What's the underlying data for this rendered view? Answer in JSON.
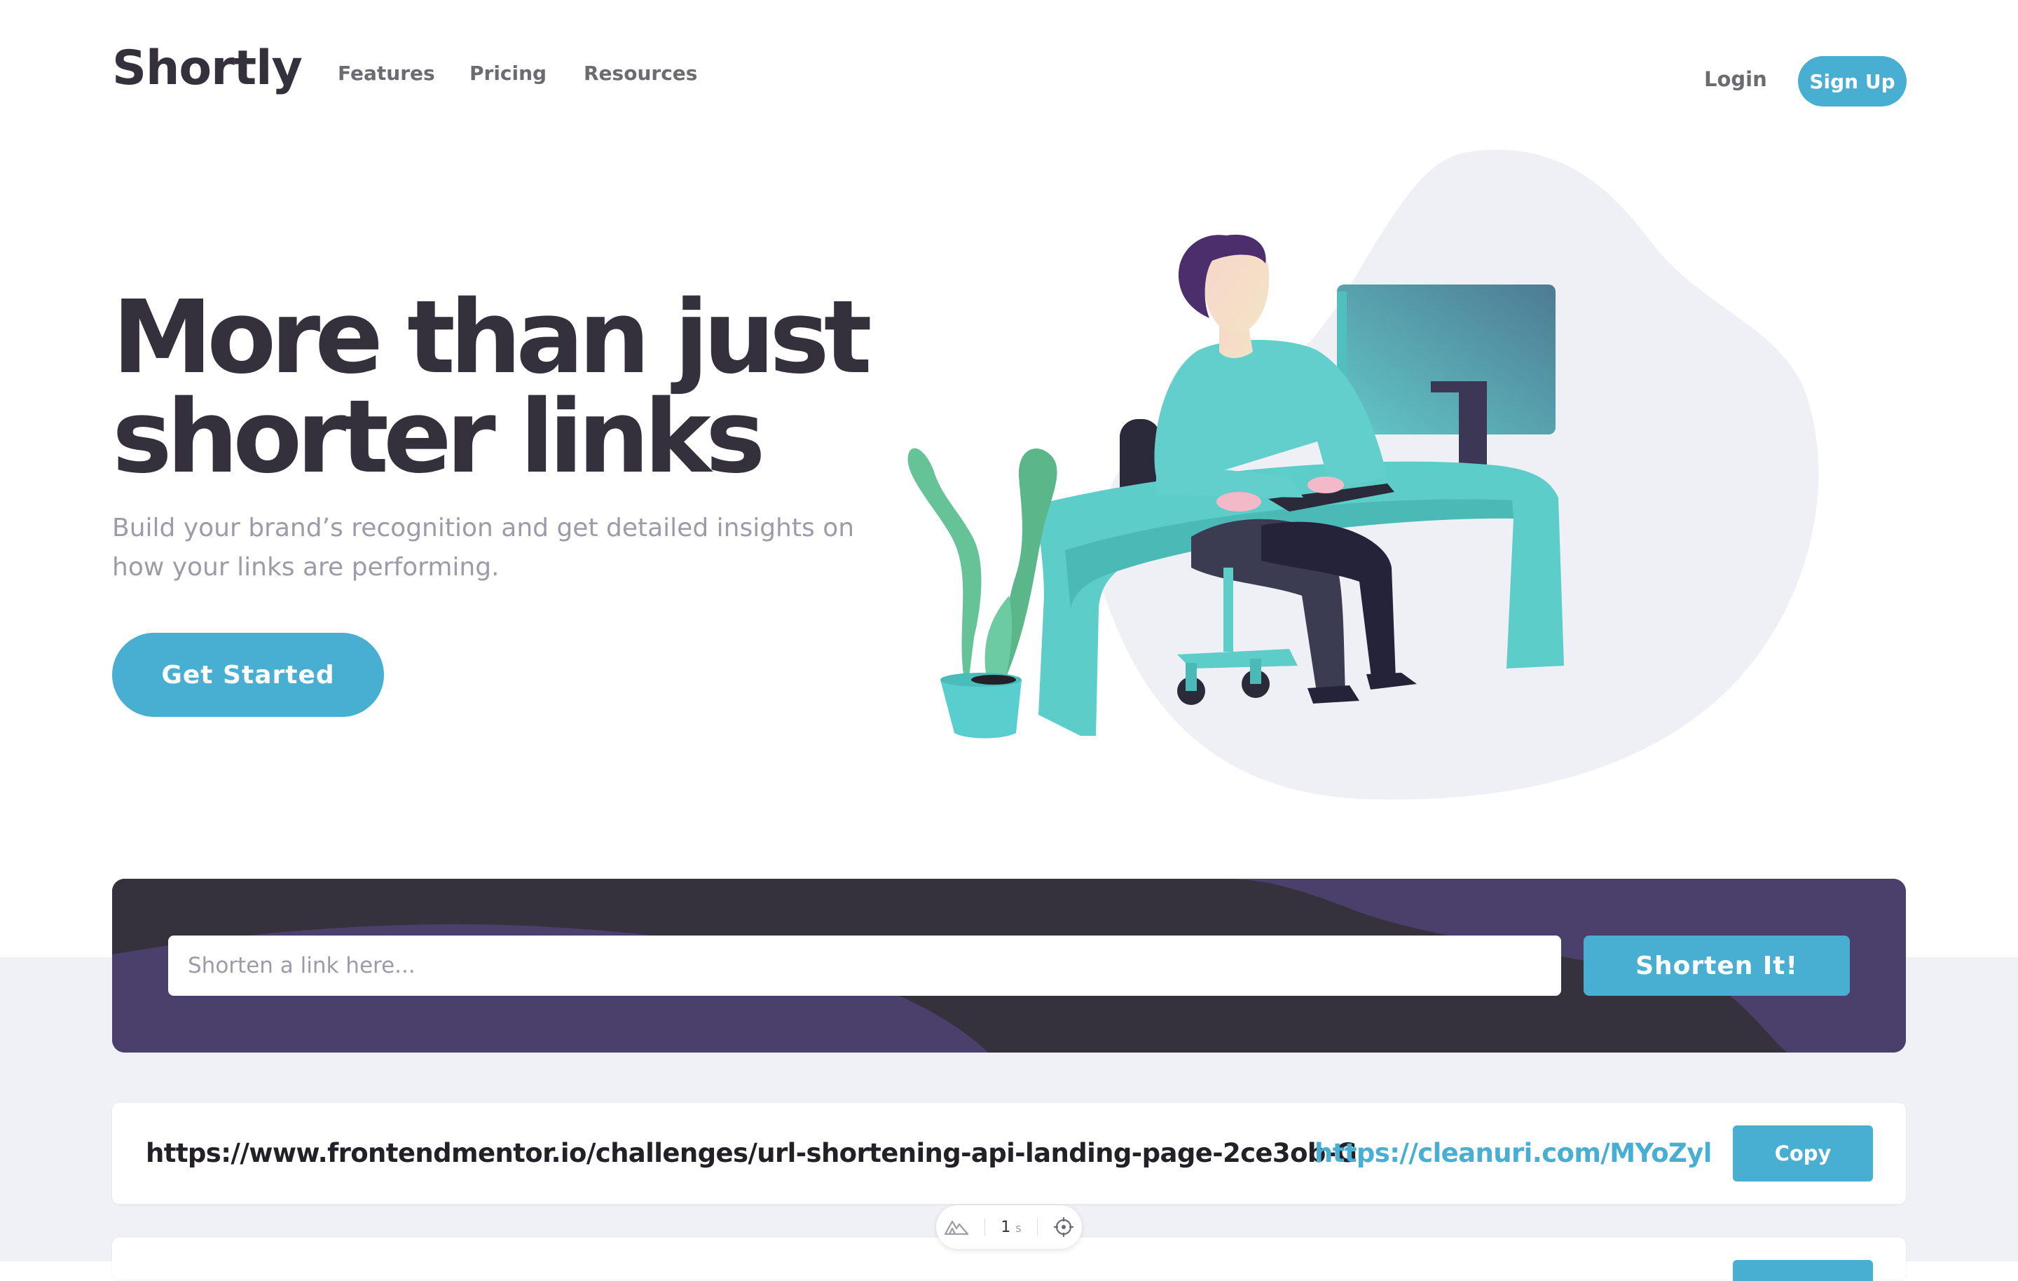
{
  "header": {
    "logo": "Shortly",
    "nav": [
      "Features",
      "Pricing",
      "Resources"
    ],
    "login": "Login",
    "signup": "Sign Up"
  },
  "hero": {
    "title_line1": "More than just",
    "title_line2": "shorter links",
    "subtitle": "Build your brand’s recognition and get detailed insights on how your links are performing.",
    "cta": "Get Started"
  },
  "shorten": {
    "placeholder": "Shorten a link here...",
    "button": "Shorten It!"
  },
  "results": [
    {
      "original": "https://www.frontendmentor.io/challenges/url-shortening-api-landing-page-2ce3ob-G",
      "short": "https://cleanuri.com/MYoZyl",
      "copy": "Copy"
    }
  ],
  "devbar": {
    "time": "1",
    "unit": "s",
    "logo_icon": "nuxt-logo-icon",
    "target_icon": "crosshair-icon"
  },
  "colors": {
    "primary": "#48aed2",
    "dark_violet": "#3a3054",
    "dark_text": "#34313d",
    "gray_text": "#9e9aa8",
    "light_bg": "#f0f1f6"
  }
}
